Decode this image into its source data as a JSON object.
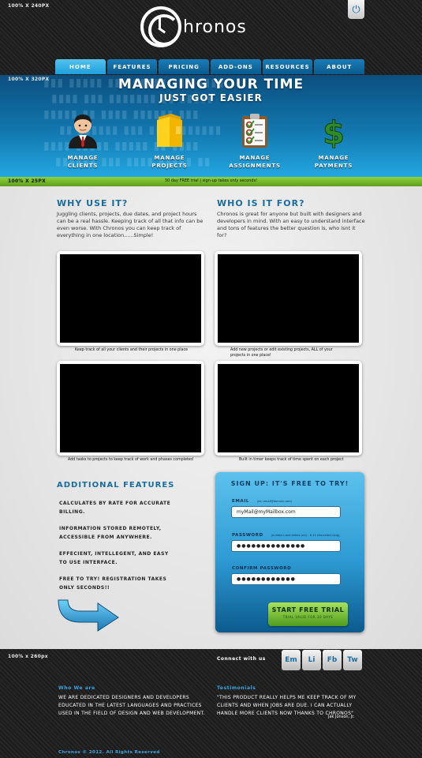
{
  "header": {
    "dim_label": "100% X 240PX",
    "logo_text": "hronos",
    "nav": [
      {
        "label": "Home",
        "active": true
      },
      {
        "label": "Features",
        "active": false
      },
      {
        "label": "Pricing",
        "active": false
      },
      {
        "label": "Add-ons",
        "active": false
      },
      {
        "label": "Resources",
        "active": false
      },
      {
        "label": "About",
        "active": false
      }
    ]
  },
  "hero": {
    "dim_label": "100% X 320PX",
    "title": "Managing your time",
    "subtitle": "just got easier",
    "features": [
      {
        "label_line1": "Manage",
        "label_line2": "Clients",
        "icon": "businessman-icon"
      },
      {
        "label_line1": "Manage",
        "label_line2": "Projects",
        "icon": "folder-icon"
      },
      {
        "label_line1": "Manage",
        "label_line2": "Assignments",
        "icon": "clipboard-checklist-icon"
      },
      {
        "label_line1": "Manage",
        "label_line2": "Payments",
        "icon": "dollar-sign-icon"
      }
    ]
  },
  "strip": {
    "dim_label": "100% X 25PX",
    "text": "30 day FREE trial | sign-up takes only seconds!"
  },
  "main": {
    "why": {
      "heading": "Why use it?",
      "text": "Juggling clients, projects, due dates, and project hours can be a real hassle. Keeping track of all that info can be even worse. With Chronos you can keep track of everything in one location......Simple!"
    },
    "who": {
      "heading": "Who is it for?",
      "text": "Chronos is great for anyone but built with designers and developers in mind. With an easy to understand interface and tons of features the better question is, who isnt it for?"
    },
    "videos": [
      {
        "caption": "Keep track of all your clients and their projects in one place"
      },
      {
        "caption": "Add new projects or edit existing projects, ALL of your projects in one place!"
      },
      {
        "caption": "Add tasks to projects to keep track of work and phases completed"
      },
      {
        "caption": "Built in timer keeps track of time spent on each project"
      }
    ],
    "additional": {
      "heading": "Additional features",
      "items": [
        "Calculates by rate for accurate billing.",
        "Information stored remotely, accessible from anywhere.",
        "Effecient, intellegent, and easy to use interface.",
        "Free to try! registration takes only seconds!!"
      ]
    },
    "signup": {
      "title": "Sign up: it's FREE to try!",
      "email_label": "Email",
      "email_hint": "(ex: email@domain.com)",
      "email_value": "myMail@myMailbox.com",
      "password_label": "Password",
      "password_hint": "(numbers and letters only - 6-12 characters long)",
      "password_value": "●●●●●●●●●●●●●●",
      "confirm_label": "Confirm Password",
      "confirm_value": "●●●●●●●●●●●●",
      "button_label": "Start Free Trial",
      "button_sub": "Trial valid for 30 days"
    }
  },
  "footer": {
    "dim_label": "100% x 260px",
    "connect_label": "Connect with us",
    "social": [
      {
        "label": "Em",
        "icon": "email-icon"
      },
      {
        "label": "Li",
        "icon": "linkedin-icon"
      },
      {
        "label": "Fb",
        "icon": "facebook-icon"
      },
      {
        "label": "Tw",
        "icon": "twitter-icon"
      }
    ],
    "who_heading": "Who We are",
    "who_text": "We are dedicated designers and developers educated in the latest languages and practices used in the field of design and web development.",
    "testimonials_heading": "Testimonials",
    "testimonial_text": "\"This product really helps me keep track of my clients and when jobs are due. I can actually handle more clients now thanks to Chronos\"",
    "testimonial_author": "Jak Jonson, Jr.",
    "copyright": "Chronos © 2012.   All Rights Reserved"
  },
  "colors": {
    "brand_blue": "#1a6d9f",
    "nav_active": "#3ab4e8",
    "trial_green": "#7ccb35"
  }
}
